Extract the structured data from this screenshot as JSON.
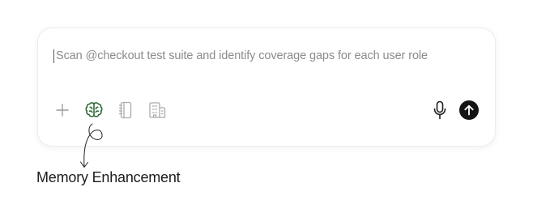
{
  "composer": {
    "prompt_text": "Scan @checkout test suite and identify coverage gaps for each user role"
  },
  "toolbar": {
    "left_tools": [
      {
        "icon": "plus-icon",
        "state": "default"
      },
      {
        "icon": "brain-icon",
        "state": "active"
      },
      {
        "icon": "notebook-icon",
        "state": "default"
      },
      {
        "icon": "building-icon",
        "state": "default"
      }
    ],
    "right_tools": [
      {
        "icon": "microphone-icon"
      },
      {
        "icon": "arrow-up-icon"
      }
    ]
  },
  "annotation": {
    "label": "Memory Enhancement"
  },
  "colors": {
    "active_icon": "#2f6b36",
    "muted_icon": "#a9a9a9",
    "send_button": "#141414",
    "prompt_text": "#8b8b8b"
  }
}
